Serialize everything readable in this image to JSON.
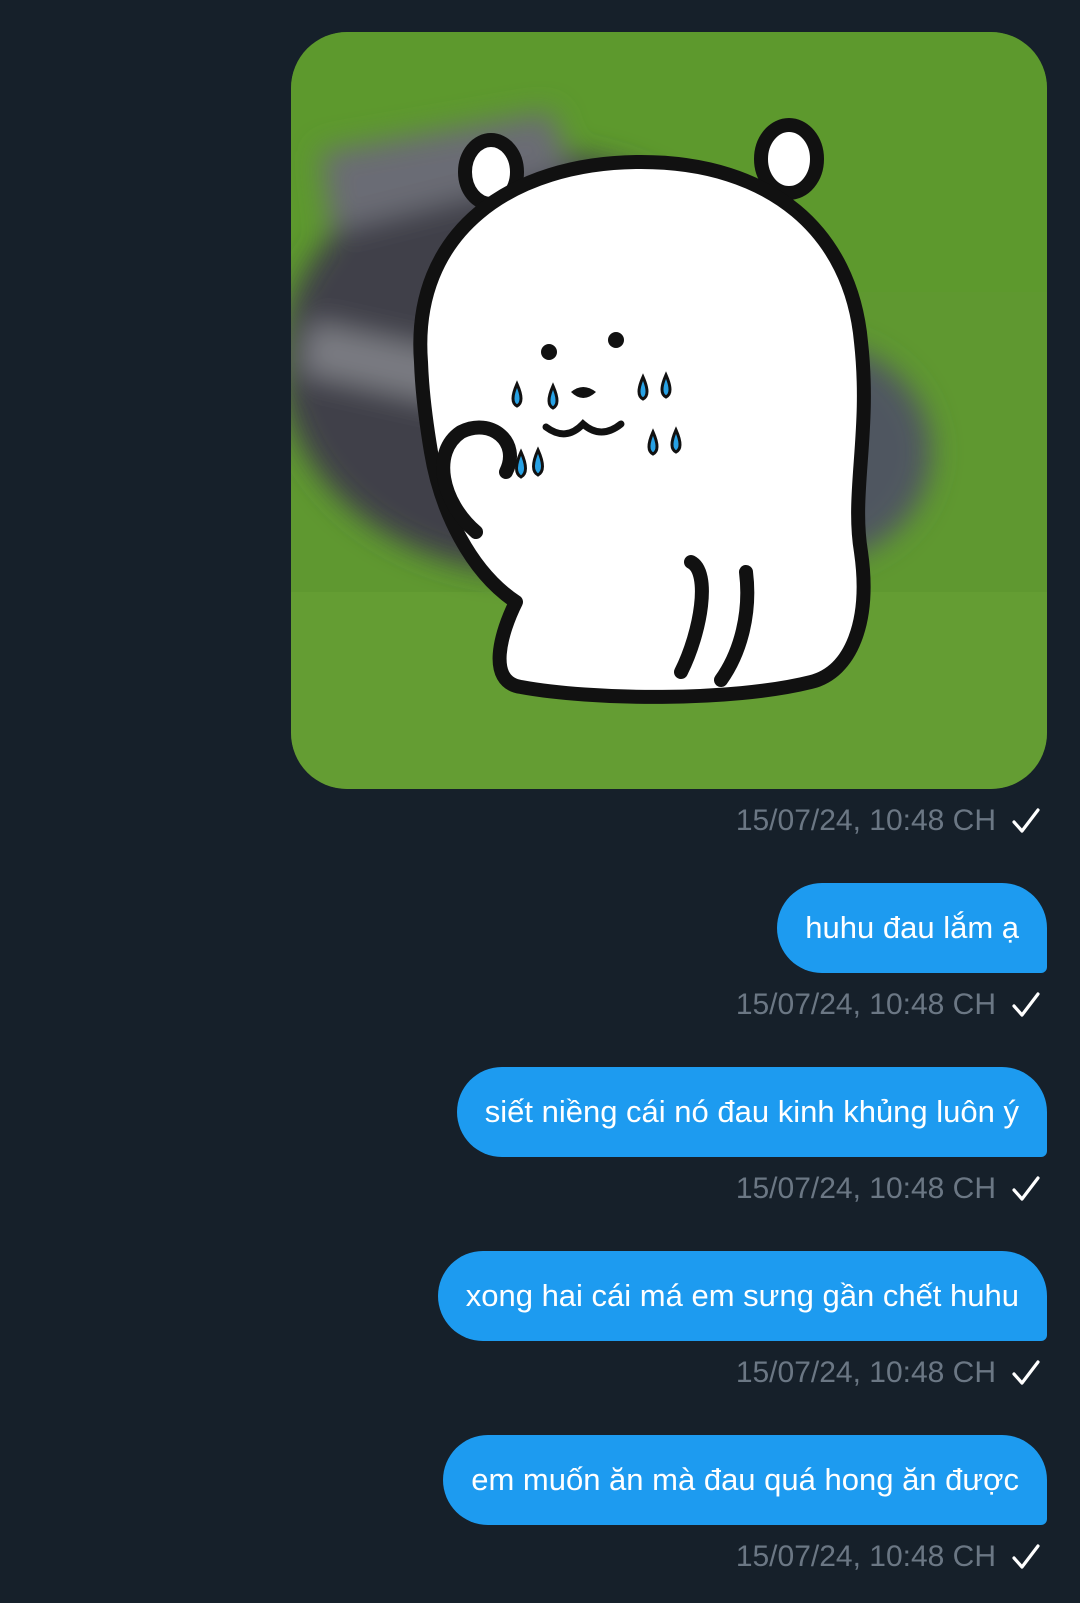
{
  "colors": {
    "background": "#16202a",
    "bubble": "#1d9bf0",
    "bubble_text": "#ffffff",
    "timestamp": "#6b7784",
    "check": "#ffffff"
  },
  "messages": [
    {
      "type": "image",
      "image_subject": "crying white bear sticker on green background",
      "timestamp": "15/07/24, 10:48 CH",
      "status_icon": "check-icon"
    },
    {
      "type": "text",
      "text": "huhu đau lắm ạ",
      "timestamp": "15/07/24, 10:48 CH",
      "status_icon": "check-icon"
    },
    {
      "type": "text",
      "text": "siết niềng cái nó đau kinh khủng luôn ý",
      "timestamp": "15/07/24, 10:48 CH",
      "status_icon": "check-icon"
    },
    {
      "type": "text",
      "text": "xong hai cái má em sưng gần chết huhu",
      "timestamp": "15/07/24, 10:48 CH",
      "status_icon": "check-icon"
    },
    {
      "type": "text",
      "text": "em muốn ăn mà đau quá hong ăn được",
      "timestamp": "15/07/24, 10:48 CH",
      "status_icon": "check-icon"
    }
  ]
}
